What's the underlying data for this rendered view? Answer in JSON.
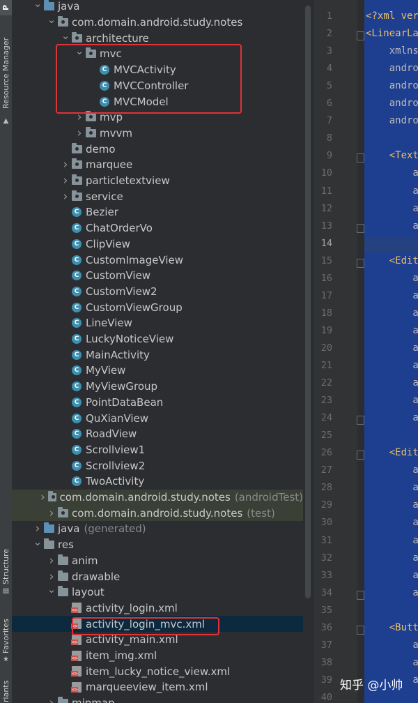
{
  "sidebar": {
    "tabs": [
      {
        "label": "P",
        "icon": "project-icon"
      },
      {
        "label": "Resource Manager",
        "icon": "resource-icon"
      },
      {
        "label": "Structure",
        "icon": "structure-icon"
      },
      {
        "label": "Favorites",
        "icon": "star-icon"
      },
      {
        "label": "riants",
        "icon": "variants-icon"
      }
    ]
  },
  "tree": [
    {
      "indent": 1,
      "arrow": "down",
      "icon": "folder-blue",
      "label": "java"
    },
    {
      "indent": 2,
      "arrow": "down",
      "icon": "package",
      "label": "com.domain.android.study.notes"
    },
    {
      "indent": 3,
      "arrow": "down",
      "icon": "package",
      "label": "architecture"
    },
    {
      "indent": 4,
      "arrow": "down",
      "icon": "package",
      "label": "mvc"
    },
    {
      "indent": 5,
      "arrow": "",
      "icon": "class",
      "label": "MVCActivity"
    },
    {
      "indent": 5,
      "arrow": "",
      "icon": "class",
      "label": "MVCController"
    },
    {
      "indent": 5,
      "arrow": "",
      "icon": "class",
      "label": "MVCModel"
    },
    {
      "indent": 4,
      "arrow": "right",
      "icon": "package",
      "label": "mvp"
    },
    {
      "indent": 4,
      "arrow": "right",
      "icon": "package",
      "label": "mvvm"
    },
    {
      "indent": 3,
      "arrow": "",
      "icon": "package",
      "label": "demo"
    },
    {
      "indent": 3,
      "arrow": "right",
      "icon": "package",
      "label": "marquee"
    },
    {
      "indent": 3,
      "arrow": "right",
      "icon": "package",
      "label": "particletextview"
    },
    {
      "indent": 3,
      "arrow": "right",
      "icon": "package",
      "label": "service"
    },
    {
      "indent": 3,
      "arrow": "",
      "icon": "class",
      "label": "Bezier"
    },
    {
      "indent": 3,
      "arrow": "",
      "icon": "class",
      "label": "ChatOrderVo"
    },
    {
      "indent": 3,
      "arrow": "",
      "icon": "class",
      "label": "ClipView"
    },
    {
      "indent": 3,
      "arrow": "",
      "icon": "class",
      "label": "CustomImageView"
    },
    {
      "indent": 3,
      "arrow": "",
      "icon": "class",
      "label": "CustomView"
    },
    {
      "indent": 3,
      "arrow": "",
      "icon": "class",
      "label": "CustomView2"
    },
    {
      "indent": 3,
      "arrow": "",
      "icon": "class",
      "label": "CustomViewGroup"
    },
    {
      "indent": 3,
      "arrow": "",
      "icon": "class",
      "label": "LineView"
    },
    {
      "indent": 3,
      "arrow": "",
      "icon": "class",
      "label": "LuckyNoticeView"
    },
    {
      "indent": 3,
      "arrow": "",
      "icon": "class",
      "label": "MainActivity"
    },
    {
      "indent": 3,
      "arrow": "",
      "icon": "class",
      "label": "MyView"
    },
    {
      "indent": 3,
      "arrow": "",
      "icon": "class",
      "label": "MyViewGroup"
    },
    {
      "indent": 3,
      "arrow": "",
      "icon": "class",
      "label": "PointDataBean"
    },
    {
      "indent": 3,
      "arrow": "",
      "icon": "class",
      "label": "QuXianView"
    },
    {
      "indent": 3,
      "arrow": "",
      "icon": "class",
      "label": "RoadView"
    },
    {
      "indent": 3,
      "arrow": "",
      "icon": "class",
      "label": "Scrollview1"
    },
    {
      "indent": 3,
      "arrow": "",
      "icon": "class",
      "label": "Scrollview2"
    },
    {
      "indent": 3,
      "arrow": "",
      "icon": "class",
      "label": "TwoActivity"
    },
    {
      "indent": 2,
      "arrow": "right",
      "icon": "package",
      "label": "com.domain.android.study.notes",
      "suffix": "(androidTest)",
      "style": "test"
    },
    {
      "indent": 2,
      "arrow": "right",
      "icon": "package",
      "label": "com.domain.android.study.notes",
      "suffix": "(test)",
      "style": "test"
    },
    {
      "indent": 1,
      "arrow": "right",
      "icon": "folder-blue",
      "label": "java",
      "suffix": "(generated)"
    },
    {
      "indent": 1,
      "arrow": "down",
      "icon": "folder",
      "label": "res"
    },
    {
      "indent": 2,
      "arrow": "right",
      "icon": "folder",
      "label": "anim"
    },
    {
      "indent": 2,
      "arrow": "right",
      "icon": "folder",
      "label": "drawable"
    },
    {
      "indent": 2,
      "arrow": "down",
      "icon": "folder",
      "label": "layout"
    },
    {
      "indent": 3,
      "arrow": "",
      "icon": "xml",
      "label": "activity_login.xml"
    },
    {
      "indent": 3,
      "arrow": "",
      "icon": "xml",
      "label": "activity_login_mvc.xml",
      "style": "selected"
    },
    {
      "indent": 3,
      "arrow": "",
      "icon": "xml",
      "label": "activity_main.xml"
    },
    {
      "indent": 3,
      "arrow": "",
      "icon": "xml",
      "label": "item_img.xml"
    },
    {
      "indent": 3,
      "arrow": "",
      "icon": "xml",
      "label": "item_lucky_notice_view.xml"
    },
    {
      "indent": 3,
      "arrow": "",
      "icon": "xml",
      "label": "marqueeview_item.xml"
    },
    {
      "indent": 2,
      "arrow": "right",
      "icon": "folder",
      "label": "mipmap"
    }
  ],
  "editor": {
    "line_numbers": [
      "1",
      "2",
      "3",
      "4",
      "5",
      "6",
      "7",
      "8",
      "9",
      "10",
      "11",
      "12",
      "13",
      "14",
      "15",
      "16",
      "17",
      "18",
      "19",
      "20",
      "21",
      "22",
      "23",
      "24",
      "25",
      "26",
      "27",
      "28",
      "29",
      "30",
      "31",
      "32",
      "33",
      "34",
      "35",
      "36",
      "37",
      "38",
      "39",
      "40"
    ],
    "current_line": "14",
    "fold_lines": [
      "2",
      "9",
      "13",
      "15",
      "24",
      "26",
      "34",
      "36"
    ],
    "code": [
      {
        "line": "1",
        "text": "<?xml ver"
      },
      {
        "line": "2",
        "text": "<LinearLa"
      },
      {
        "line": "3",
        "text": "    xmlns:",
        "attr": true
      },
      {
        "line": "4",
        "text": "    andro",
        "attr": true
      },
      {
        "line": "5",
        "text": "    andro",
        "attr": true
      },
      {
        "line": "6",
        "text": "    andro",
        "attr": true
      },
      {
        "line": "7",
        "text": "    andro",
        "attr": true
      },
      {
        "line": "9",
        "text": "    <Text"
      },
      {
        "line": "10",
        "text": "        a",
        "attr": true
      },
      {
        "line": "11",
        "text": "        a",
        "attr": true
      },
      {
        "line": "12",
        "text": "        a",
        "attr": true
      },
      {
        "line": "13",
        "text": "        a",
        "attr": true
      },
      {
        "line": "15",
        "text": "    <Edit"
      },
      {
        "line": "16",
        "text": "        a",
        "attr": true
      },
      {
        "line": "17",
        "text": "        a",
        "attr": true
      },
      {
        "line": "18",
        "text": "        a",
        "attr": true
      },
      {
        "line": "19",
        "text": "        a",
        "attr": true
      },
      {
        "line": "20",
        "text": "        a",
        "attr": true
      },
      {
        "line": "21",
        "text": "        a",
        "attr": true
      },
      {
        "line": "22",
        "text": "        a",
        "attr": true
      },
      {
        "line": "23",
        "text": "        a",
        "attr": true
      },
      {
        "line": "24",
        "text": "        a",
        "attr": true
      },
      {
        "line": "26",
        "text": "    <Edit"
      },
      {
        "line": "27",
        "text": "        a",
        "attr": true
      },
      {
        "line": "28",
        "text": "        a",
        "attr": true
      },
      {
        "line": "29",
        "text": "        a",
        "attr": true
      },
      {
        "line": "30",
        "text": "        a",
        "attr": true
      },
      {
        "line": "31",
        "text": "        a",
        "attr": true
      },
      {
        "line": "32",
        "text": "        a",
        "attr": true
      },
      {
        "line": "33",
        "text": "        a",
        "attr": true
      },
      {
        "line": "34",
        "text": "        a",
        "attr": true
      },
      {
        "line": "36",
        "text": "    <Butt"
      },
      {
        "line": "37",
        "text": "        a",
        "attr": true
      },
      {
        "line": "38",
        "text": "        a",
        "attr": true
      },
      {
        "line": "39",
        "text": "        a",
        "attr": true
      }
    ]
  },
  "watermark": "知乎 @小帅",
  "colors": {
    "highlight_box": "#e0323a",
    "selection": "#0d293e",
    "editor_bg": "#1e3f8f",
    "class_icon": "#3d8fb0"
  }
}
